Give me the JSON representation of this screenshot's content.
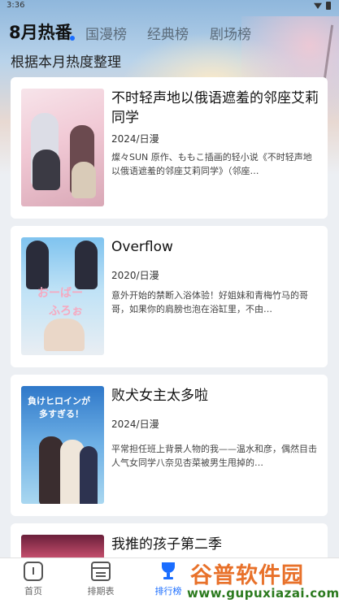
{
  "status_bar": {
    "time": "3:36"
  },
  "tabs": [
    {
      "label": "8月热番",
      "active": true
    },
    {
      "label": "国漫榜",
      "active": false
    },
    {
      "label": "经典榜",
      "active": false
    },
    {
      "label": "剧场榜",
      "active": false
    }
  ],
  "subtitle": "根据本月热度整理",
  "cards": [
    {
      "title": "不时轻声地以俄语遮羞的邻座艾莉同学",
      "meta": "2024/日漫",
      "desc": "燦々SUN 原作、ももこ插画的轻小说《不时轻声地以俄语遮羞的邻座艾莉同学》（邻座…"
    },
    {
      "title": "Overflow",
      "meta": "2020/日漫",
      "desc": "意外开始的禁断入浴体验！好姐妹和青梅竹马的哥哥，如果你的肩膀也泡在浴缸里，不由…"
    },
    {
      "title": "败犬女主太多啦",
      "meta": "2024/日漫",
      "desc": "平常担任班上背景人物的我——温水和彦，偶然目击人气女同学八奈见杏菜被男生甩掉的…"
    },
    {
      "title": "我推的孩子第二季",
      "meta": "",
      "desc": ""
    }
  ],
  "bottom_nav": [
    {
      "label": "首页",
      "icon": "home-icon"
    },
    {
      "label": "排期表",
      "icon": "calendar-icon"
    },
    {
      "label": "排行榜",
      "icon": "trophy-icon",
      "active": true
    }
  ],
  "watermark": {
    "title": "谷普软件园",
    "url": "www.gupuxiazai.com"
  },
  "colors": {
    "accent": "#1a6dff",
    "card": "#ffffff",
    "background": "#eceff3"
  }
}
